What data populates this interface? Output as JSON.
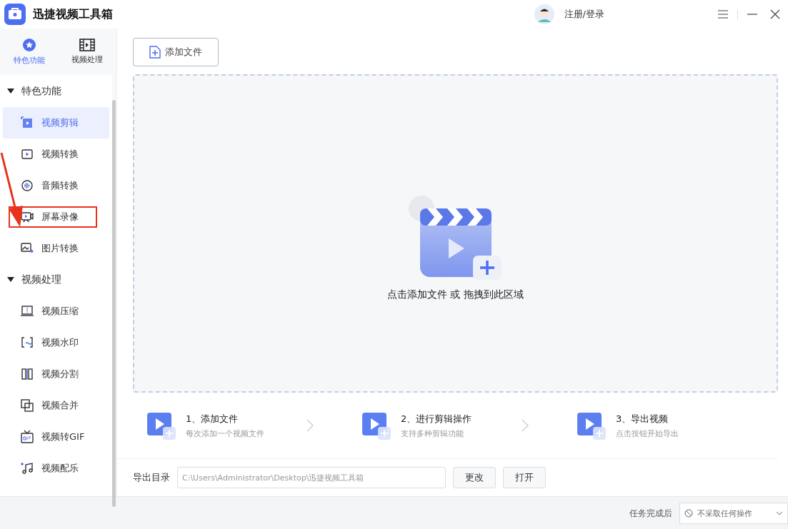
{
  "app": {
    "title": "迅捷视频工具箱"
  },
  "header": {
    "login": "注册/登录"
  },
  "side_tabs": [
    {
      "label": "特色功能",
      "selected": true
    },
    {
      "label": "视频处理",
      "selected": false
    }
  ],
  "sidebar": {
    "sections": [
      {
        "title": "特色功能",
        "expanded": true,
        "items": [
          {
            "label": "视频剪辑",
            "selected": true,
            "highlighted": false
          },
          {
            "label": "视频转换",
            "selected": false,
            "highlighted": false
          },
          {
            "label": "音频转换",
            "selected": false,
            "highlighted": false
          },
          {
            "label": "屏幕录像",
            "selected": false,
            "highlighted": true
          },
          {
            "label": "图片转换",
            "selected": false,
            "highlighted": false
          }
        ]
      },
      {
        "title": "视频处理",
        "expanded": true,
        "items": [
          {
            "label": "视频压缩",
            "selected": false,
            "highlighted": false
          },
          {
            "label": "视频水印",
            "selected": false,
            "highlighted": false
          },
          {
            "label": "视频分割",
            "selected": false,
            "highlighted": false
          },
          {
            "label": "视频合并",
            "selected": false,
            "highlighted": false
          },
          {
            "label": "视频转GIF",
            "selected": false,
            "highlighted": false
          },
          {
            "label": "视频配乐",
            "selected": false,
            "highlighted": false
          }
        ]
      }
    ]
  },
  "main": {
    "add_button": "添加文件",
    "drop_hint": "点击添加文件 或 拖拽到此区域",
    "steps": [
      {
        "title": "1、添加文件",
        "subtitle": "每次添加一个视频文件"
      },
      {
        "title": "2、进行剪辑操作",
        "subtitle": "支持多种剪辑功能"
      },
      {
        "title": "3、导出视频",
        "subtitle": "点击按钮开始导出"
      }
    ],
    "export": {
      "label": "导出目录",
      "path": "C:\\Users\\Administrator\\Desktop\\迅捷视频工具箱",
      "buttons": [
        "更改",
        "打开"
      ]
    }
  },
  "footer": {
    "label": "任务完成后",
    "option": "不采取任何操作"
  }
}
